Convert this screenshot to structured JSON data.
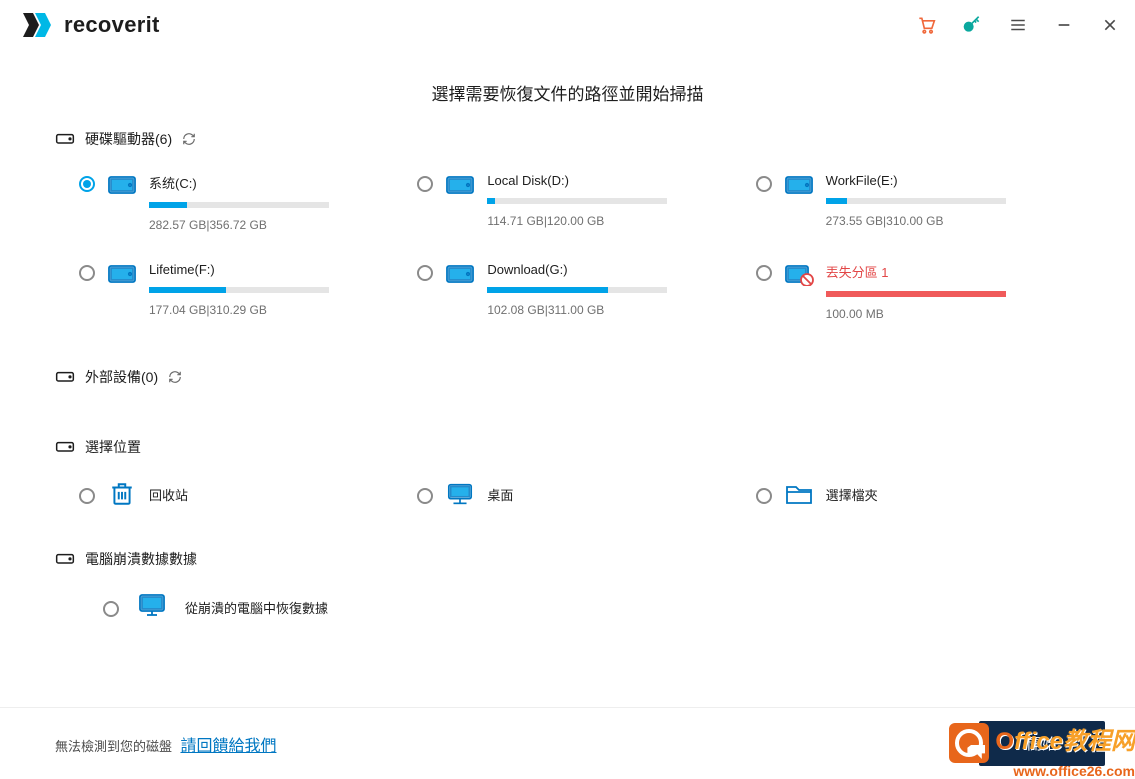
{
  "app": {
    "name": "recoverit"
  },
  "titlebar": {
    "cart": "cart",
    "key": "key",
    "menu": "menu",
    "min": "minimize",
    "close": "close"
  },
  "main_title": "選擇需要恢復文件的路徑並開始掃描",
  "sections": {
    "drives": {
      "label": "硬碟驅動器(6)"
    },
    "external": {
      "label": "外部設備(0)"
    },
    "locations": {
      "label": "選擇位置"
    },
    "crash": {
      "label": "電腦崩潰數據數據"
    }
  },
  "drives": [
    {
      "name": "系统(C:)",
      "used_pct": 21,
      "size": "282.57 GB|356.72 GB",
      "selected": true,
      "lost": false
    },
    {
      "name": "Local Disk(D:)",
      "used_pct": 4,
      "size": "114.71 GB|120.00 GB",
      "selected": false,
      "lost": false
    },
    {
      "name": "WorkFile(E:)",
      "used_pct": 12,
      "size": "273.55 GB|310.00 GB",
      "selected": false,
      "lost": false
    },
    {
      "name": "Lifetime(F:)",
      "used_pct": 43,
      "size": "177.04 GB|310.29 GB",
      "selected": false,
      "lost": false
    },
    {
      "name": "Download(G:)",
      "used_pct": 67,
      "size": "102.08 GB|311.00 GB",
      "selected": false,
      "lost": false
    },
    {
      "name": "丟失分區 1",
      "used_pct": 100,
      "size": "100.00 MB",
      "selected": false,
      "lost": true
    }
  ],
  "locations": [
    {
      "name": "回收站",
      "icon": "trash"
    },
    {
      "name": "桌面",
      "icon": "desktop"
    },
    {
      "name": "選擇檔夾",
      "icon": "folder"
    }
  ],
  "crash_item": {
    "label": "從崩潰的電腦中恢復數據"
  },
  "footer": {
    "text": "無法檢測到您的磁盤",
    "link": "請回饋給我們",
    "button": "開始"
  },
  "watermark": {
    "line1": "Office教程网",
    "line2": "www.office26.com"
  }
}
